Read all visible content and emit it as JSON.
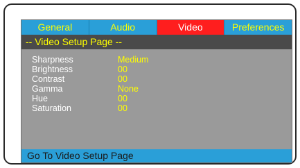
{
  "tabs": [
    {
      "label": "General",
      "active": false
    },
    {
      "label": "Audio",
      "active": false
    },
    {
      "label": "Video",
      "active": true
    },
    {
      "label": "Preferences",
      "active": false
    }
  ],
  "page_title": "-- Video Setup Page --",
  "settings": [
    {
      "label": "Sharpness",
      "value": "Medium"
    },
    {
      "label": "Brightness",
      "value": "00"
    },
    {
      "label": "Contrast",
      "value": "00"
    },
    {
      "label": "Gamma",
      "value": "None"
    },
    {
      "label": "Hue",
      "value": "00"
    },
    {
      "label": "Saturation",
      "value": "00"
    }
  ],
  "status_text": "Go To Video Setup Page",
  "colors": {
    "tab_bar": "#2a9fd8",
    "tab_active": "#ff1e1e",
    "tab_text": "#ffff00",
    "title_bar": "#4a4a4a",
    "panel": "#9a9a9a",
    "value_text": "#ffff00",
    "label_text": "#ffffff"
  }
}
